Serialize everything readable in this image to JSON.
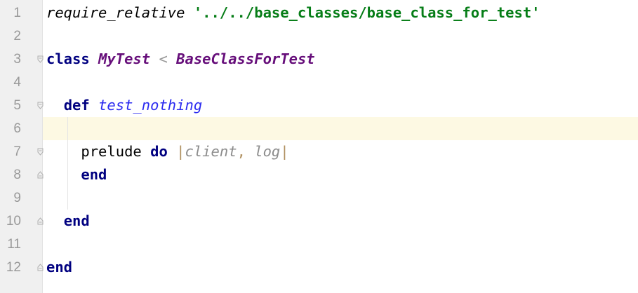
{
  "editor": {
    "current_line": 6,
    "line_numbers": [
      "1",
      "2",
      "3",
      "4",
      "5",
      "6",
      "7",
      "8",
      "9",
      "10",
      "11",
      "12"
    ],
    "lines": {
      "l1": {
        "method": "require_relative",
        "space": " ",
        "string": "'../../base_classes/base_class_for_test'"
      },
      "l3": {
        "kw": "class",
        "sp1": " ",
        "name": "MyTest",
        "sp2": " ",
        "op": "<",
        "sp3": " ",
        "parent": "BaseClassForTest"
      },
      "l5": {
        "indent": "  ",
        "kw": "def",
        "sp": " ",
        "name": "test_nothing"
      },
      "l7": {
        "indent": "    ",
        "call": "prelude",
        "sp1": " ",
        "kw": "do",
        "sp2": " ",
        "pipe1": "|",
        "p1": "client",
        "comma": ", ",
        "p2": "log",
        "pipe2": "|"
      },
      "l8": {
        "indent": "    ",
        "kw": "end"
      },
      "l10": {
        "indent": "  ",
        "kw": "end"
      },
      "l12": {
        "kw": "end"
      }
    },
    "colors": {
      "keyword": "#000080",
      "string": "#067d17",
      "constant": "#660e7a",
      "definition": "#2b2bf0",
      "parameter": "#8c8c8c",
      "current_line_bg": "#fdf9e3",
      "gutter_bg": "#f0f0f0"
    },
    "fold_icons": [
      "fold-open-icon",
      "fold-close-icon"
    ]
  }
}
